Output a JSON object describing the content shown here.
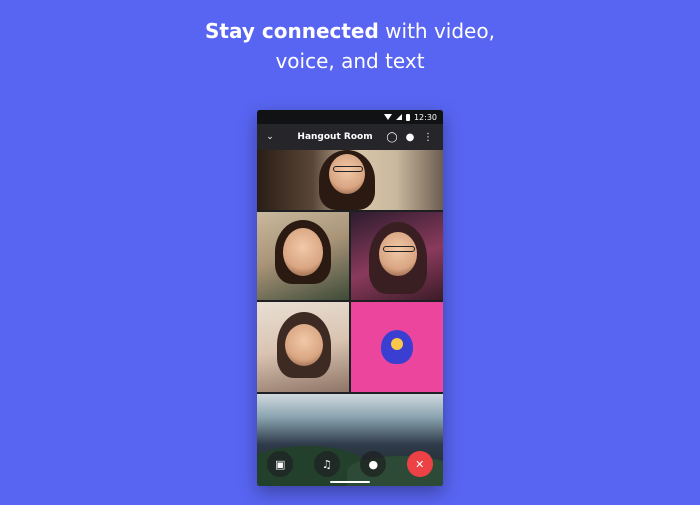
{
  "headline": {
    "bold": "Stay connected",
    "rest_line1": " with video,",
    "line2": "voice, and text"
  },
  "status_bar": {
    "time": "12:30"
  },
  "call_header": {
    "room_name": "Hangout Room",
    "icons": [
      "chevron-down-icon",
      "add-user-icon",
      "participants-icon",
      "more-icon"
    ]
  },
  "colors": {
    "background": "#5865f2",
    "avatar_tile": "#eb459e",
    "end_call": "#ed4245"
  },
  "tiles": [
    {
      "name": "video-tile-1"
    },
    {
      "name": "video-tile-2"
    },
    {
      "name": "video-tile-3"
    },
    {
      "name": "video-tile-4"
    },
    {
      "name": "avatar-tile"
    },
    {
      "name": "screen-share-tile"
    }
  ],
  "controls": [
    "video-camera-icon",
    "speaker-icon",
    "microphone-icon",
    "end-call-icon"
  ]
}
